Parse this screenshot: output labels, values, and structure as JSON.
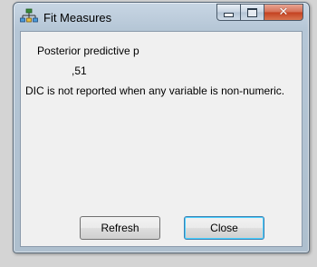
{
  "window": {
    "title": "Fit Measures",
    "icon": "network-diagram-icon",
    "controls": [
      "minimize",
      "maximize",
      "close"
    ]
  },
  "content": {
    "ppp_label": "Posterior predictive p",
    "ppp_value": ",51",
    "message": "DIC is not reported when any variable is non-numeric."
  },
  "buttons": {
    "refresh": "Refresh",
    "close": "Close"
  },
  "colors": {
    "close_button": "#c3401f",
    "client_background": "#f0f0f0",
    "frame": "#b5c6d6"
  }
}
